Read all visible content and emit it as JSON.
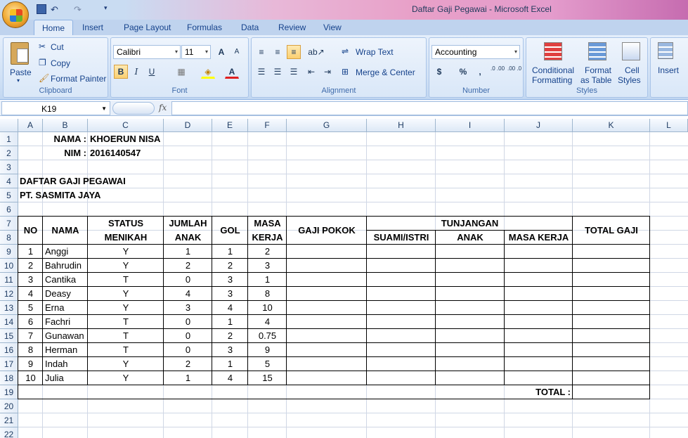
{
  "window": {
    "title": "Daftar Gaji Pegawai - Microsoft Excel"
  },
  "tabs": [
    "Home",
    "Insert",
    "Page Layout",
    "Formulas",
    "Data",
    "Review",
    "View"
  ],
  "clipboard": {
    "paste": "Paste",
    "cut": "Cut",
    "copy": "Copy",
    "format_painter": "Format Painter",
    "label": "Clipboard"
  },
  "font": {
    "name": "Calibri",
    "size": "11",
    "label": "Font",
    "bold": "B",
    "italic": "I",
    "underline": "U",
    "grow": "A",
    "shrink": "A",
    "font_color": "A"
  },
  "alignment": {
    "wrap": "Wrap Text",
    "merge": "Merge & Center",
    "label": "Alignment"
  },
  "number": {
    "format": "Accounting",
    "currency": "$",
    "percent": "%",
    "comma": ",",
    "inc": ".0 .00",
    "dec": ".00 .0",
    "label": "Number"
  },
  "styles": {
    "cond": "Conditional",
    "cond2": "Formatting",
    "table": "Format",
    "table2": "as Table",
    "cell": "Cell",
    "cell2": "Styles",
    "label": "Styles"
  },
  "cells_group": {
    "insert": "Insert"
  },
  "formula_bar": {
    "name_box": "K19",
    "fx": "fx",
    "value": ""
  },
  "columns": [
    "A",
    "B",
    "C",
    "D",
    "E",
    "F",
    "G",
    "H",
    "I",
    "J",
    "K",
    "L"
  ],
  "rows": [
    "1",
    "2",
    "3",
    "4",
    "5",
    "6",
    "7",
    "8",
    "9",
    "10",
    "11",
    "12",
    "13",
    "14",
    "15",
    "16",
    "17",
    "18",
    "19",
    "20",
    "21",
    "22"
  ],
  "sheet": {
    "nama_label": "NAMA :",
    "nama_value": "KHOERUN NISA",
    "nim_label": "NIM :",
    "nim_value": "2016140547",
    "title1": "DAFTAR GAJI PEGAWAI",
    "title2": "PT. SASMITA JAYA",
    "headers": {
      "no": "NO",
      "nama": "NAMA",
      "status1": "STATUS",
      "status2": "MENIKAH",
      "jumlah1": "JUMLAH",
      "jumlah2": "ANAK",
      "gol": "GOL",
      "masa1": "MASA",
      "masa2": "KERJA",
      "gaji": "GAJI POKOK",
      "tunjangan": "TUNJANGAN",
      "suami": "SUAMI/ISTRI",
      "anak": "ANAK",
      "masakerja": "MASA KERJA",
      "total": "TOTAL GAJI"
    },
    "data": [
      [
        "1",
        "Anggi",
        "Y",
        "1",
        "1",
        "2"
      ],
      [
        "2",
        "Bahrudin",
        "Y",
        "2",
        "2",
        "3"
      ],
      [
        "3",
        "Cantika",
        "T",
        "0",
        "3",
        "1"
      ],
      [
        "4",
        "Deasy",
        "Y",
        "4",
        "3",
        "8"
      ],
      [
        "5",
        "Erna",
        "Y",
        "3",
        "4",
        "10"
      ],
      [
        "6",
        "Fachri",
        "T",
        "0",
        "1",
        "4"
      ],
      [
        "7",
        "Gunawan",
        "T",
        "0",
        "2",
        "0.75"
      ],
      [
        "8",
        "Herman",
        "T",
        "0",
        "3",
        "9"
      ],
      [
        "9",
        "Indah",
        "Y",
        "2",
        "1",
        "5"
      ],
      [
        "10",
        "Julia",
        "Y",
        "1",
        "4",
        "15"
      ]
    ],
    "total_label": "TOTAL :"
  }
}
